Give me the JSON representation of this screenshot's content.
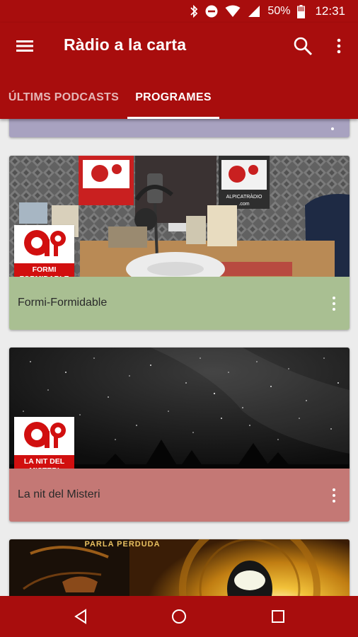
{
  "status_bar": {
    "battery_percent": "50%",
    "time": "12:31",
    "icons": [
      "bluetooth-icon",
      "do-not-disturb-icon",
      "wifi-icon",
      "cell-signal-icon",
      "battery-icon"
    ]
  },
  "app_bar": {
    "title": "Ràdio a la carta",
    "icons": [
      "menu-icon",
      "search-icon",
      "more-vert-icon"
    ],
    "color": "#a80d0d"
  },
  "tabs": [
    {
      "label": "ÚLTIMS PODCASTS",
      "selected": false
    },
    {
      "label": "PROGRAMES",
      "selected": true
    }
  ],
  "programs": [
    {
      "title": "Formi-Formidable",
      "logo_text": "FORMI FORMIDABLE",
      "color": "#a9bf92"
    },
    {
      "title": "La nit del Misteri",
      "logo_text": "LA NIT DEL MISTERI",
      "color": "#c47875"
    },
    {
      "title": "",
      "banner_text": "PARLA PERDUDA"
    }
  ],
  "image_texts": {
    "studio_banner": "ALPICATRÀDIO",
    "studio_banner_url": ".com"
  },
  "nav_bar": {
    "icons": [
      "back-icon",
      "home-icon",
      "recent-apps-icon"
    ]
  }
}
